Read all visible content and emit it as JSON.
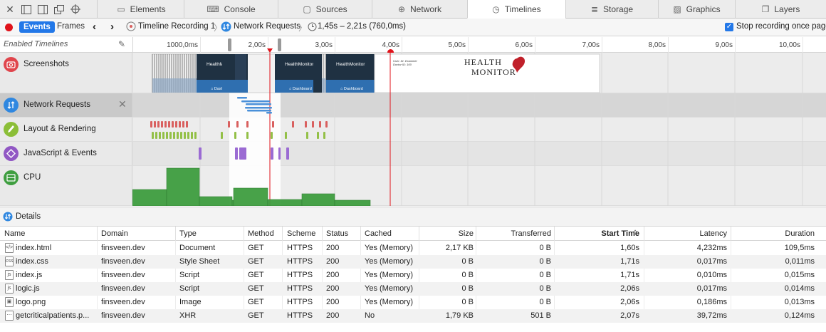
{
  "tabs": [
    {
      "label": "Elements",
      "icon": "elements-icon",
      "active": false
    },
    {
      "label": "Console",
      "icon": "console-icon",
      "active": false
    },
    {
      "label": "Sources",
      "icon": "sources-icon",
      "active": false
    },
    {
      "label": "Network",
      "icon": "network-icon",
      "active": false
    },
    {
      "label": "Timelines",
      "icon": "timelines-icon",
      "active": true
    },
    {
      "label": "Storage",
      "icon": "storage-icon",
      "active": false
    },
    {
      "label": "Graphics",
      "icon": "graphics-icon",
      "active": false
    },
    {
      "label": "Layers",
      "icon": "layers-icon",
      "active": false
    }
  ],
  "navbar": {
    "events_label": "Events",
    "frames_label": "Frames",
    "recording_name": "Timeline Recording 1",
    "network_requests": "Network Requests",
    "time_range": "1,45s – 2,21s (760,0ms)",
    "stop_recording_label": "Stop recording once page loads",
    "stop_recording_checked": true
  },
  "timeline": {
    "enabled_label": "Enabled Timelines",
    "ruler_ticks": [
      "1000,0ms",
      "2,00s",
      "3,00s",
      "4,00s",
      "5,00s",
      "6,00s",
      "7,00s",
      "8,00s",
      "9,00s",
      "10,00s"
    ],
    "rows": [
      {
        "label": "Screenshots",
        "icon": "camera-icon",
        "color": "#e0454c"
      },
      {
        "label": "Network Requests",
        "icon": "network-requests-icon",
        "color": "#2f87e0"
      },
      {
        "label": "Layout & Rendering",
        "icon": "paintbrush-icon",
        "color": "#8bbe37"
      },
      {
        "label": "JavaScript & Events",
        "icon": "javascript-icon",
        "color": "#9157c4"
      },
      {
        "label": "CPU",
        "icon": "cpu-icon",
        "color": "#3f9e40"
      }
    ],
    "screenshot_thumbs": [
      "HealthMonitor",
      "HealthMonitor",
      "HealthMonitor"
    ],
    "thumb_nav_labels": [
      "Dashb",
      "Dashboard",
      "Dashboard"
    ],
    "health_monitor_text": "HEALTH MONITOR",
    "user_text": [
      "User: Dr. Examiner",
      "Doctor ID: 100"
    ]
  },
  "details": {
    "title": "Details",
    "columns": [
      "Name",
      "Domain",
      "Type",
      "Method",
      "Scheme",
      "Status",
      "Cached",
      "Size",
      "Transferred",
      "Start Time",
      "Latency",
      "Duration"
    ],
    "rows": [
      {
        "icon": "html-file-icon",
        "name": "index.html",
        "domain": "finsveen.dev",
        "type": "Document",
        "method": "GET",
        "scheme": "HTTPS",
        "status": "200",
        "cached": "Yes (Memory)",
        "size": "2,17 KB",
        "transferred": "0 B",
        "start": "1,60s",
        "latency": "4,232ms",
        "duration": "109,5ms"
      },
      {
        "icon": "css-file-icon",
        "name": "index.css",
        "domain": "finsveen.dev",
        "type": "Style Sheet",
        "method": "GET",
        "scheme": "HTTPS",
        "status": "200",
        "cached": "Yes (Memory)",
        "size": "0 B",
        "transferred": "0 B",
        "start": "1,71s",
        "latency": "0,017ms",
        "duration": "0,011ms"
      },
      {
        "icon": "js-file-icon",
        "name": "index.js",
        "domain": "finsveen.dev",
        "type": "Script",
        "method": "GET",
        "scheme": "HTTPS",
        "status": "200",
        "cached": "Yes (Memory)",
        "size": "0 B",
        "transferred": "0 B",
        "start": "1,71s",
        "latency": "0,010ms",
        "duration": "0,015ms"
      },
      {
        "icon": "js-file-icon",
        "name": "logic.js",
        "domain": "finsveen.dev",
        "type": "Script",
        "method": "GET",
        "scheme": "HTTPS",
        "status": "200",
        "cached": "Yes (Memory)",
        "size": "0 B",
        "transferred": "0 B",
        "start": "2,06s",
        "latency": "0,017ms",
        "duration": "0,014ms"
      },
      {
        "icon": "image-file-icon",
        "name": "logo.png",
        "domain": "finsveen.dev",
        "type": "Image",
        "method": "GET",
        "scheme": "HTTPS",
        "status": "200",
        "cached": "Yes (Memory)",
        "size": "0 B",
        "transferred": "0 B",
        "start": "2,06s",
        "latency": "0,186ms",
        "duration": "0,013ms"
      },
      {
        "icon": "xhr-file-icon",
        "name": "getcriticalpatients.p...",
        "domain": "finsveen.dev",
        "type": "XHR",
        "method": "GET",
        "scheme": "HTTPS",
        "status": "200",
        "cached": "No",
        "size": "1,79 KB",
        "transferred": "501 B",
        "start": "2,07s",
        "latency": "39,72ms",
        "duration": "0,124ms"
      }
    ]
  },
  "colors": {
    "accent": "#2378e8",
    "record": "#e0131a",
    "cpu_fill": "#3f9e40",
    "layout_red": "#d9605f",
    "layout_green": "#93c047",
    "js_purple": "#9b6bd3",
    "network_blue": "#4a90d9"
  }
}
